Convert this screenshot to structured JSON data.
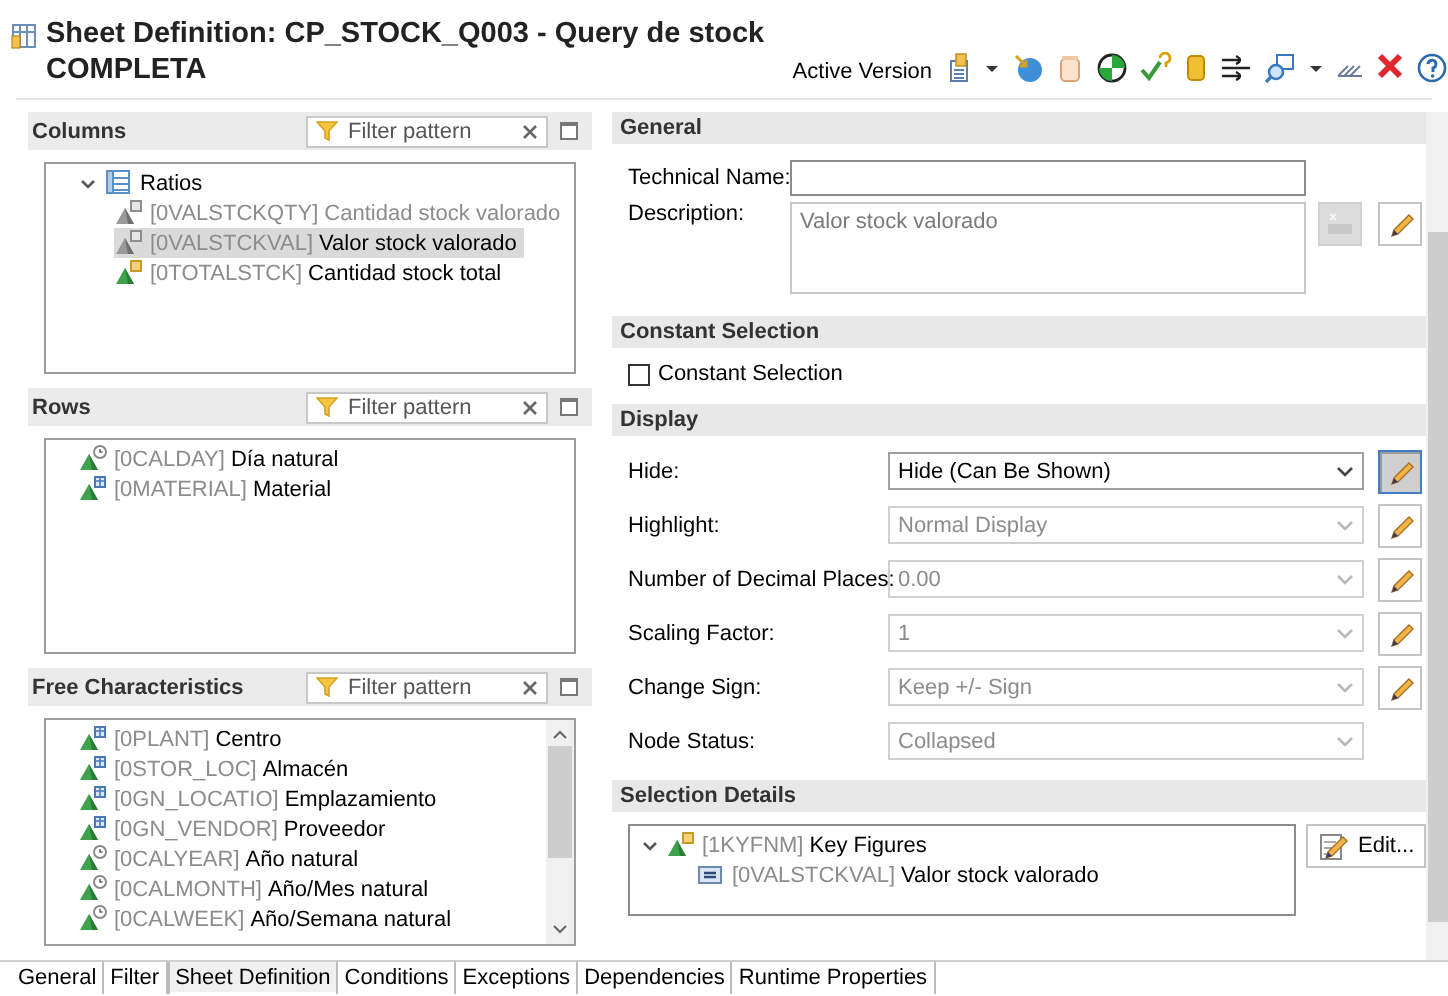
{
  "header": {
    "title": "Sheet Definition: CP_STOCK_Q003 - Query de stock COMPLETA",
    "version_label": "Active Version"
  },
  "panels": [
    {
      "title": "Columns",
      "filter": {
        "placeholder": "Filter pattern"
      },
      "scrollbar": false,
      "tree": [
        {
          "kind": "structure",
          "name": "Ratios",
          "expanded": true,
          "selected": false,
          "dimmed": false,
          "children": [
            {
              "kind": "keyfigure_hidden",
              "code": "[0VALSTCKQTY]",
              "name": "Cantidad stock valorado",
              "dimmed": true,
              "selected": false
            },
            {
              "kind": "keyfigure_hidden",
              "code": "[0VALSTCKVAL]",
              "name": "Valor stock valorado",
              "dimmed": false,
              "selected": true
            },
            {
              "kind": "keyfigure",
              "code": "[0TOTALSTCK]",
              "name": "Cantidad stock total",
              "dimmed": false,
              "selected": false
            }
          ]
        }
      ]
    },
    {
      "title": "Rows",
      "filter": {
        "placeholder": "Filter pattern"
      },
      "scrollbar": false,
      "tree": [
        {
          "kind": "time",
          "code": "[0CALDAY]",
          "name": "Día natural",
          "dimmed": false,
          "selected": false
        },
        {
          "kind": "characteristic",
          "code": "[0MATERIAL]",
          "name": "Material",
          "dimmed": false,
          "selected": false
        }
      ]
    },
    {
      "title": "Free Characteristics",
      "filter": {
        "placeholder": "Filter pattern"
      },
      "scrollbar": true,
      "tree": [
        {
          "kind": "characteristic",
          "code": "[0PLANT]",
          "name": "Centro",
          "dimmed": false,
          "selected": false
        },
        {
          "kind": "characteristic",
          "code": "[0STOR_LOC]",
          "name": "Almacén",
          "dimmed": false,
          "selected": false
        },
        {
          "kind": "characteristic",
          "code": "[0GN_LOCATIO]",
          "name": "Emplazamiento",
          "dimmed": false,
          "selected": false
        },
        {
          "kind": "characteristic",
          "code": "[0GN_VENDOR]",
          "name": "Proveedor",
          "dimmed": false,
          "selected": false
        },
        {
          "kind": "time",
          "code": "[0CALYEAR]",
          "name": "Año natural",
          "dimmed": false,
          "selected": false
        },
        {
          "kind": "time",
          "code": "[0CALMONTH]",
          "name": "Año/Mes natural",
          "dimmed": false,
          "selected": false
        },
        {
          "kind": "time",
          "code": "[0CALWEEK]",
          "name": "Año/Semana natural",
          "dimmed": false,
          "selected": false
        }
      ]
    }
  ],
  "general": {
    "title": "General",
    "technical_name": {
      "label": "Technical Name:"
    },
    "description": {
      "label": "Description:",
      "value": "Valor stock valorado",
      "disabled": true
    }
  },
  "constant_selection": {
    "title": "Constant Selection",
    "checkbox": {
      "label": "Constant Selection",
      "checked": false
    }
  },
  "display": {
    "title": "Display",
    "rows": [
      {
        "label": "Hide:",
        "value": "Hide (Can Be Shown)",
        "disabled": false,
        "edit_button": {
          "pressed": true
        }
      },
      {
        "label": "Highlight:",
        "value": "Normal Display",
        "disabled": true,
        "edit_button": {
          "pressed": false
        }
      },
      {
        "label": "Number of Decimal Places:",
        "value": "0.00",
        "disabled": true,
        "edit_button": {
          "pressed": false
        }
      },
      {
        "label": "Scaling Factor:",
        "value": "1",
        "disabled": true,
        "edit_button": {
          "pressed": false
        }
      },
      {
        "label": "Change Sign:",
        "value": "Keep +/- Sign",
        "disabled": true,
        "edit_button": {
          "pressed": false
        }
      },
      {
        "label": "Node Status:",
        "value": "Collapsed",
        "disabled": true
      }
    ]
  },
  "selection_details": {
    "title": "Selection Details",
    "edit_label": "Edit...",
    "tree": [
      {
        "kind": "keyfigure",
        "code": "[1KYFNM]",
        "name": "Key Figures",
        "expanded": true,
        "dimmed": false,
        "selected": false,
        "children": [
          {
            "kind": "member",
            "code": "[0VALSTCKVAL]",
            "name": "Valor stock valorado",
            "dimmed": false,
            "selected": false
          }
        ]
      }
    ]
  },
  "tabs": [
    {
      "label": "General",
      "selected": false
    },
    {
      "label": "Filter",
      "selected": false
    },
    {
      "label": "Sheet Definition",
      "selected": true
    },
    {
      "label": "Conditions",
      "selected": false
    },
    {
      "label": "Exceptions",
      "selected": false
    },
    {
      "label": "Dependencies",
      "selected": false
    },
    {
      "label": "Runtime Properties",
      "selected": false
    }
  ]
}
